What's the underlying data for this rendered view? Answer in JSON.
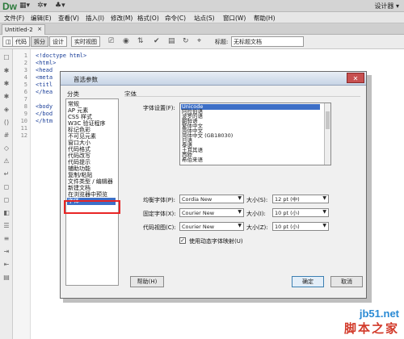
{
  "app": {
    "logo": "Dw",
    "workspace": "设计器 ▾"
  },
  "menubar": [
    "文件(F)",
    "编辑(E)",
    "查看(V)",
    "插入(I)",
    "修改(M)",
    "格式(O)",
    "命令(C)",
    "站点(S)",
    "窗口(W)",
    "帮助(H)"
  ],
  "tab": {
    "name": "Untitled-2",
    "close": "×"
  },
  "toolbar": {
    "code": "代码",
    "split": "拆分",
    "design": "设计",
    "live": "实时视图",
    "title_label": "标题:",
    "title_value": "无标题文档"
  },
  "code_lines": {
    "numbers": [
      "1",
      "2",
      "3",
      "4",
      "5",
      "6",
      "7",
      "8",
      "9",
      "10",
      "11",
      "12"
    ],
    "text": [
      "<!doctype html>",
      "<html>",
      "<head",
      "<meta",
      "<titl",
      "</hea",
      "",
      "<body",
      "</bod",
      "</htm"
    ]
  },
  "dialog": {
    "title": "首选参数",
    "category_header": "分类",
    "section_header": "字体",
    "categories": [
      "常规",
      "AP 元素",
      "CSS 样式",
      "W3C 验证程序",
      "标记色彩",
      "不可见元素",
      "窗口大小",
      "代码格式",
      "代码改写",
      "代码提示",
      "辅助功能",
      "复制/粘贴",
      "文件类型 / 编辑器",
      "新建文档",
      "在浏览器中预览",
      "字体"
    ],
    "selected_category": "字体",
    "font_settings_label": "字体设置(F):",
    "encodings": [
      "Unicode",
      "阿拉伯语",
      "波罗的语",
      "朝鲜语",
      "繁体中文",
      "简体中文",
      "简体中文 (GB18030)",
      "日语",
      "泰语",
      "土耳其语",
      "西欧",
      "希伯来语"
    ],
    "selected_encoding": "Unicode",
    "proportional": {
      "label": "均衡字体(P):",
      "font": "Cordia New",
      "size_label": "大小(S):",
      "size": "12 pt (中)"
    },
    "fixed": {
      "label": "固定字体(X):",
      "font": "Courier New",
      "size_label": "大小(I):",
      "size": "10 pt (小)"
    },
    "codeview": {
      "label": "代码视图(C):",
      "font": "Courier New",
      "size_label": "大小(Z):",
      "size": "10 pt (小)"
    },
    "dynamic_mapping": "使用动态字体映射(U)",
    "dynamic_checked": true,
    "help": "帮助(H)",
    "ok": "确定",
    "cancel": "取消"
  },
  "watermark": {
    "line1": "jb51.net",
    "line2": "脚本之家"
  },
  "colors": {
    "highlight": "#e82525",
    "selection": "#3d6fc7",
    "logo": "#2b7a3a"
  }
}
